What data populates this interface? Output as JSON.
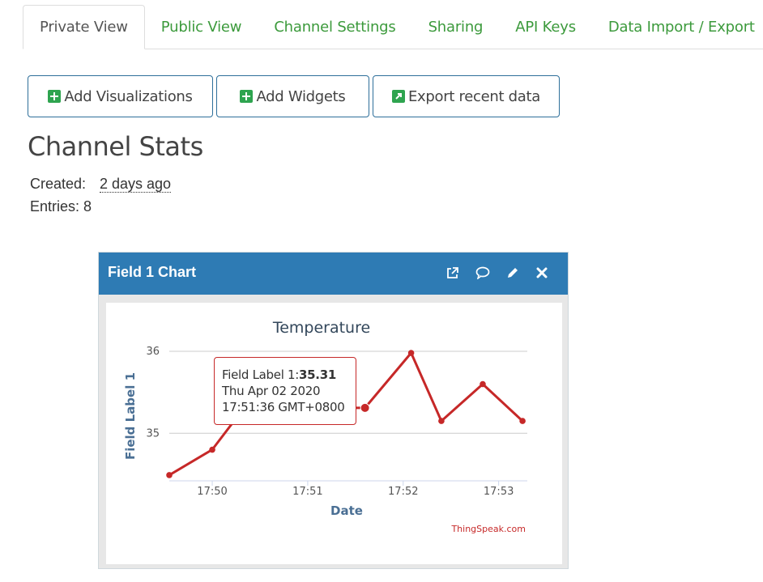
{
  "tabs": [
    {
      "label": "Private View",
      "active": true
    },
    {
      "label": "Public View",
      "active": false
    },
    {
      "label": "Channel Settings",
      "active": false
    },
    {
      "label": "Sharing",
      "active": false
    },
    {
      "label": "API Keys",
      "active": false
    },
    {
      "label": "Data Import / Export",
      "active": false
    }
  ],
  "buttons": {
    "add_visualizations": "Add Visualizations",
    "add_widgets": "Add Widgets",
    "export_recent": "Export recent data"
  },
  "stats": {
    "title": "Channel Stats",
    "created_label": "Created:",
    "created_value": "2 days ago",
    "entries_label": "Entries: 8"
  },
  "widget": {
    "title": "Field 1 Chart",
    "icons": [
      "external-link-icon",
      "comment-icon",
      "pencil-icon",
      "close-icon"
    ]
  },
  "tooltip": {
    "label": "Field Label 1:",
    "value": "35.31",
    "date": "Thu Apr 02 2020",
    "time": "17:51:36 GMT+0800"
  },
  "colors": {
    "tab_link": "#3c9a3c",
    "header": "#2e7bb4",
    "series": "#c62828",
    "axis_label": "#4a6f94"
  },
  "chart_data": {
    "type": "line",
    "title": "Temperature",
    "xlabel": "Date",
    "ylabel": "Field Label 1",
    "credit": "ThingSpeak.com",
    "x_ticks": [
      "17:50",
      "17:51",
      "17:52",
      "17:53"
    ],
    "y_ticks": [
      35,
      36
    ],
    "xlim": [
      "17:49:33",
      "17:53:18"
    ],
    "ylim": [
      34.42,
      36.0
    ],
    "grid": true,
    "legend": "none",
    "series": [
      {
        "points": [
          {
            "x": "17:49:33",
            "y": 34.49
          },
          {
            "x": "17:50:00",
            "y": 34.8
          },
          {
            "x": "17:50:20",
            "y": 35.31
          },
          {
            "x": "17:51:36",
            "y": 35.31
          },
          {
            "x": "17:52:05",
            "y": 35.98
          },
          {
            "x": "17:52:24",
            "y": 35.15
          },
          {
            "x": "17:52:50",
            "y": 35.6
          },
          {
            "x": "17:53:15",
            "y": 35.15
          }
        ],
        "highlight_index": 3
      }
    ]
  }
}
